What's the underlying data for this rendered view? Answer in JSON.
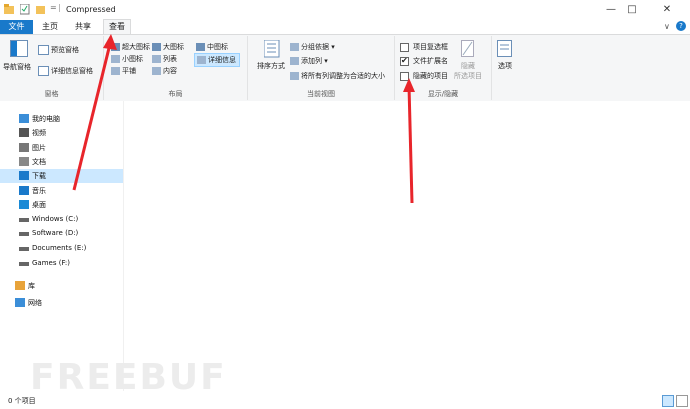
{
  "window": {
    "title": "Compressed"
  },
  "tabs": {
    "file": "文件",
    "home": "主页",
    "share": "共享",
    "view": "查看"
  },
  "ribbon": {
    "panes": {
      "nav_pane": "导航窗格",
      "preview_pane": "预览窗格",
      "details_pane": "详细信息窗格",
      "label": "窗格"
    },
    "layout": {
      "xl_icons": "超大图标",
      "large_icons": "大图标",
      "medium_icons": "中图标",
      "small_icons": "小图标",
      "list": "列表",
      "details": "详细信息",
      "tiles": "平铺",
      "content": "内容",
      "label": "布局"
    },
    "current_view": {
      "sort_by": "排序方式",
      "group_by": "分组依据",
      "add_columns": "添加列",
      "fit_columns": "将所有列调整为合适的大小",
      "label": "当前视图"
    },
    "show_hide": {
      "item_checkboxes": "项目复选框",
      "file_extensions": "文件扩展名",
      "hidden_items": "隐藏的项目",
      "hide": "隐藏",
      "hide_selected": "所选项目",
      "label": "显示/隐藏",
      "checks": {
        "item_checkboxes": false,
        "file_extensions": true,
        "hidden_items": false
      }
    },
    "options": "选项"
  },
  "nav": [
    {
      "label": "我的电脑",
      "icon": "computer-icon"
    },
    {
      "label": "视频",
      "icon": "video-icon"
    },
    {
      "label": "图片",
      "icon": "picture-icon"
    },
    {
      "label": "文档",
      "icon": "document-icon"
    },
    {
      "label": "下载",
      "icon": "download-icon",
      "selected": true
    },
    {
      "label": "音乐",
      "icon": "music-icon"
    },
    {
      "label": "桌面",
      "icon": "desktop-icon"
    },
    {
      "label": "Windows (C:)",
      "icon": "drive-icon"
    },
    {
      "label": "Software (D:)",
      "icon": "drive-icon"
    },
    {
      "label": "Documents (E:)",
      "icon": "drive-icon"
    },
    {
      "label": "Games (F:)",
      "icon": "drive-icon"
    },
    {
      "label": "库",
      "icon": "library-icon"
    },
    {
      "label": "网络",
      "icon": "network-icon"
    }
  ],
  "status": {
    "item_count": "0 个项目"
  },
  "watermark": "FREEBUF",
  "colors": {
    "accent": "#1979ca",
    "arrow": "#e8252b",
    "selected": "#cce8ff"
  }
}
